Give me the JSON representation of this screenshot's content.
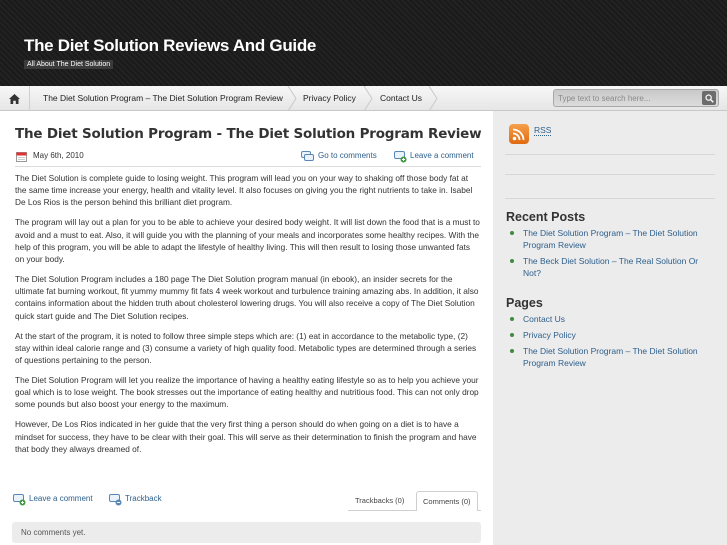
{
  "header": {
    "title": "The Diet Solution Reviews And Guide",
    "description": "All About The Diet Solution"
  },
  "nav": {
    "home_icon": "home-icon",
    "items": [
      {
        "label": "The Diet Solution Program – The Diet Solution Program Review"
      },
      {
        "label": "Privacy Policy"
      },
      {
        "label": "Contact Us"
      }
    ]
  },
  "search": {
    "placeholder": "Type text to search here...",
    "icon": "search-icon"
  },
  "post": {
    "title": "The Diet Solution Program - The Diet Solution Program Review",
    "date": "May 6th, 2010",
    "go_to_comments": "Go to comments",
    "leave_comment": "Leave a comment",
    "paragraphs": [
      "The Diet Solution is complete guide to losing weight. This program will lead you on your way to shaking off those body fat at the same time increase your energy, health and vitality level. It also focuses on giving you the right nutrients to take in. Isabel De Los Rios is the person behind this brilliant diet program.",
      "The program will lay out a plan for you to be able to achieve your desired body weight. It will list down the food that is a must to avoid and a must to eat. Also, it will guide you with the planning of your meals and incorporates some healthy recipes. With the help of this program, you will be able to adapt the lifestyle of healthy living. This will then result to losing those unwanted fats on your body.",
      "The Diet Solution Program includes a 180 page The Diet Solution program manual (in ebook), an insider secrets for the ultimate fat burning workout, fit yummy mummy fit fats 4 week workout and turbulence training amazing abs. In addition, it also contains information about the hidden truth about cholesterol lowering drugs. You will also receive a copy of The Diet Solution quick start guide and The Diet Solution recipes.",
      "At the start of the program, it is noted to follow three simple steps which are: (1) eat in accordance to the metabolic type, (2) stay within ideal calorie range and (3) consume a variety of high quality food. Metabolic types are determined through a series of questions pertaining to the person.",
      "The Diet Solution Program will let you realize the importance of having a healthy eating lifestyle so as to help you achieve your goal which is to lose weight. The book stresses out the importance of eating healthy and nutritious food. This can not only drop some pounds but also boost your energy to the maximum.",
      "However, De Los Rios indicated in her guide that the very first thing a person should do when going on a diet is to have a mindset for success, they have to be clear with their goal. This will serve as their determination to finish the program and have that body they always dreamed of."
    ],
    "footer_leave_comment": "Leave a comment",
    "footer_trackback": "Trackback",
    "tab_trackbacks": "Trackbacks (0)",
    "tab_comments": "Comments (0)",
    "no_comments": "No comments yet."
  },
  "sidebar": {
    "rss_label": "RSS",
    "recent_posts_title": "Recent Posts",
    "recent_posts": [
      "The Diet Solution Program – The Diet Solution Program Review",
      "The Beck Diet Solution – The Real Solution Or Not?"
    ],
    "pages_title": "Pages",
    "pages": [
      "Contact Us",
      "Privacy Policy",
      "The Diet Solution Program – The Diet Solution Program Review"
    ]
  },
  "colors": {
    "header_bg": "#1c1c1c",
    "link": "#2d5f8c",
    "sidebar_bg": "#ececec",
    "bullet": "#3f8a3f"
  }
}
